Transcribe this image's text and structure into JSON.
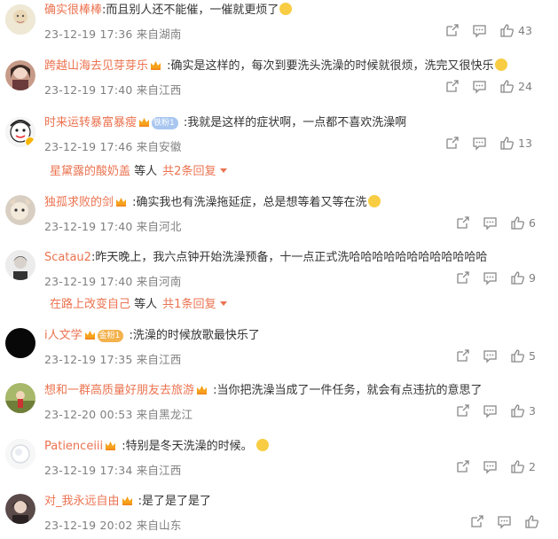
{
  "comments": [
    {
      "user": "确实很棒棒",
      "sep": ":",
      "text": "而且别人还不能催，一催就更烦了",
      "date": "23-12-19 17:36",
      "loc": "来自湖南",
      "likes": "43"
    },
    {
      "user": "跨越山海去见芽芽乐",
      "sep": " :",
      "text": "确实是这样的，每次到要洗头洗澡的时候就很烦，洗完又很快乐",
      "date": "23-12-19 17:40",
      "loc": "来自江西",
      "likes": "24"
    },
    {
      "user": "时来运转暴富暴瘦",
      "badge": "铁粉1",
      "sep": " :",
      "text": "我就是这样的症状啊，一点都不喜欢洗澡啊",
      "date": "23-12-19 17:46",
      "loc": "来自安徽",
      "likes": "13",
      "replies": {
        "user": "星黛露的酸奶盖",
        "mid": "等人",
        "more": "共2条回复"
      }
    },
    {
      "user": "独孤求败的剑",
      "sep": " :",
      "text": "确实我也有洗澡拖延症，总是想等着又等在洗",
      "date": "23-12-19 17:40",
      "loc": "来自河北",
      "likes": "6"
    },
    {
      "user": "Scatau2",
      "sep": ":",
      "text": "昨天晚上，我六点钟开始洗澡预备，十一点正式洗哈哈哈哈哈哈哈哈哈哈哈哈",
      "date": "23-12-19 17:40",
      "loc": "来自河南",
      "likes": "9",
      "replies": {
        "user": "在路上改变自己",
        "mid": "等人",
        "more": "共1条回复"
      }
    },
    {
      "user": "i人文学",
      "badge": "金粉1",
      "sep": " :",
      "text": "洗澡的时候放歌最快乐了",
      "date": "23-12-19 17:35",
      "loc": "来自江西",
      "likes": "5"
    },
    {
      "user": "想和一群高质量好朋友去旅游",
      "sep": " :",
      "text": "当你把洗澡当成了一件任务，就会有点违抗的意思了",
      "date": "23-12-20 00:53",
      "loc": "来自黑龙江",
      "likes": "3"
    },
    {
      "user": "Patienceiii",
      "sep": " :",
      "text": "特别是冬天洗澡的时候。",
      "date": "23-12-19 17:34",
      "loc": "来自江西",
      "likes": "2"
    },
    {
      "user": "对_我永远自由",
      "sep": " :",
      "text": "是了是了是了",
      "date": "23-12-19 20:02",
      "loc": "来自山东",
      "likes": ""
    }
  ]
}
